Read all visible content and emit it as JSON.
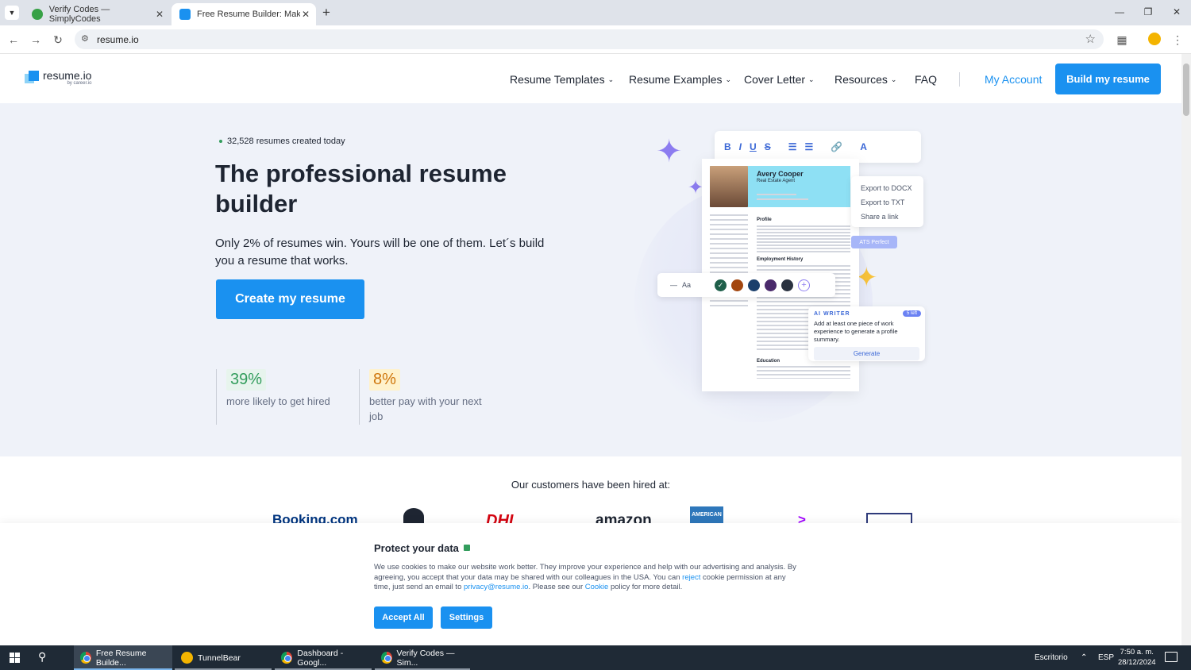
{
  "browser": {
    "tabs": [
      {
        "label": "Verify Codes — SimplyCodes",
        "active": false
      },
      {
        "label": "Free Resume Builder: Make & D",
        "active": true
      }
    ],
    "new_tab": "+",
    "url": "resume.io"
  },
  "site": {
    "logo_text": "resume.io",
    "logo_sub": "by career.io",
    "nav": [
      {
        "label": "Resume Templates",
        "dropdown": true
      },
      {
        "label": "Resume Examples",
        "dropdown": true
      },
      {
        "label": "Cover Letter",
        "dropdown": true
      },
      {
        "label": "Resources",
        "dropdown": true
      },
      {
        "label": "FAQ",
        "dropdown": false
      }
    ],
    "my_account": "My Account",
    "build_btn": "Build my resume",
    "accent": "#1a91f0"
  },
  "hero": {
    "counter": "32,528 resumes created today",
    "title": "The professional resume builder",
    "subtitle": "Only 2% of resumes win. Yours will be one of them. Let´s build you a resume that works.",
    "cta": "Create my resume",
    "stats": [
      {
        "value": "39%",
        "label": "more likely to get hired",
        "color": "#339d5d",
        "bg": "#e7f4ed"
      },
      {
        "value": "8%",
        "label": "better pay with your next job",
        "color": "#cf760d",
        "bg": "#fff2cc"
      }
    ]
  },
  "illustration": {
    "resume_name": "Avery Cooper",
    "resume_role": "Real Estate Agent",
    "sections": [
      "Profile",
      "Employment History",
      "Education"
    ],
    "export_menu": [
      "Export to DOCX",
      "Export to TXT",
      "Share a link"
    ],
    "ats_badge": "ATS Perfect",
    "font_label": "Aa",
    "swatches": [
      "#1f5f4a",
      "#a3470f",
      "#1a3f6b",
      "#4a2a6b",
      "#2a3240"
    ],
    "ai_writer": {
      "label": "AI WRITER",
      "badge": "5 left",
      "text": "Add at least one piece of work experience to generate a profile summary.",
      "button": "Generate"
    }
  },
  "customers": {
    "title": "Our customers have been hired at:",
    "brands": [
      "Booking.com",
      "",
      "DHL",
      "amazon",
      "AMERICAN",
      ">",
      ""
    ]
  },
  "cookie": {
    "title": "Protect your data",
    "text_1": "We use cookies to make our website work better. They improve your experience and help with our advertising and analysis. By agreeing, you accept that your data may be shared with our colleagues in the USA. You can ",
    "reject": "reject",
    "text_2": " cookie permission at any time, just send an email to ",
    "email": "privacy@resume.io",
    "text_3": ". Please see our ",
    "cookie_link": "Cookie",
    "text_4": " policy for more detail.",
    "accept": "Accept All",
    "settings": "Settings"
  },
  "taskbar": {
    "items": [
      {
        "label": "Free Resume Builde...",
        "active": true
      },
      {
        "label": "TunnelBear",
        "active": false
      },
      {
        "label": "Dashboard - Googl...",
        "active": false
      },
      {
        "label": "Verify Codes — Sim...",
        "active": false
      }
    ],
    "desktop": "Escritorio",
    "lang": "ESP",
    "time": "7:50 a. m.",
    "date": "28/12/2024"
  }
}
